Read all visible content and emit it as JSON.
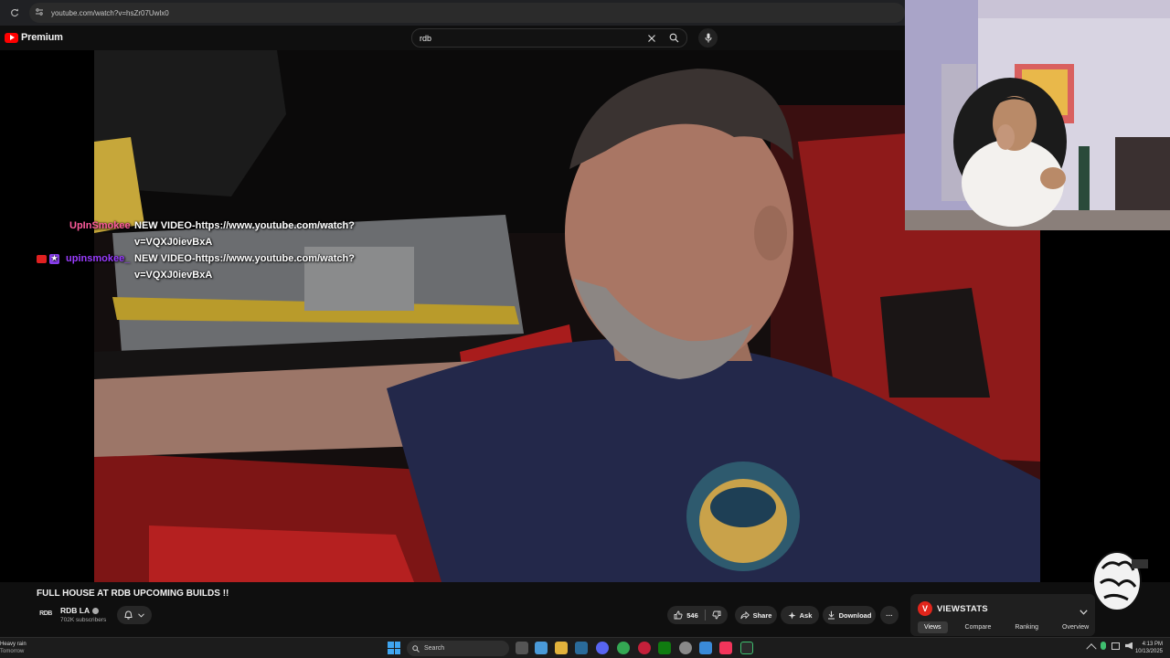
{
  "browser": {
    "url": "youtube.com/watch?v=hsZr07Uwlx0"
  },
  "header": {
    "logo_label": "Premium",
    "search_value": "rdb"
  },
  "chat": [
    {
      "user": "UpInSmokee",
      "message_line1": "NEW VIDEO-https://www.youtube.com/watch?",
      "message_line2": "v=VQXJ0ievBxA"
    },
    {
      "user": "upinsmokee_",
      "message_line1": "NEW VIDEO-https://www.youtube.com/watch?",
      "message_line2": "v=VQXJ0ievBxA"
    }
  ],
  "video": {
    "title": "FULL HOUSE AT RDB UPCOMING BUILDS !!",
    "channel": "RDB LA",
    "channel_avatar_text": "RDB",
    "subscribers": "702K subscribers",
    "likes": "546",
    "share_label": "Share",
    "ask_label": "Ask",
    "download_label": "Download",
    "more_label": "···"
  },
  "viewstats": {
    "title": "VIEWSTATS",
    "logo_letter": "V",
    "tabs": [
      "Views",
      "Compare",
      "Ranking",
      "Overview"
    ],
    "active_tab": "Views"
  },
  "taskbar": {
    "weather_line1": "Heavy rain",
    "weather_line2": "Tomorrow",
    "search_label": "Search",
    "time": "4:13 PM",
    "date": "10/13/2025"
  },
  "colors": {
    "youtube_red": "#ff0000",
    "chat_user1": "#ff5c9d",
    "chat_user2": "#9a3cff",
    "viewstats_red": "#e1251b"
  }
}
